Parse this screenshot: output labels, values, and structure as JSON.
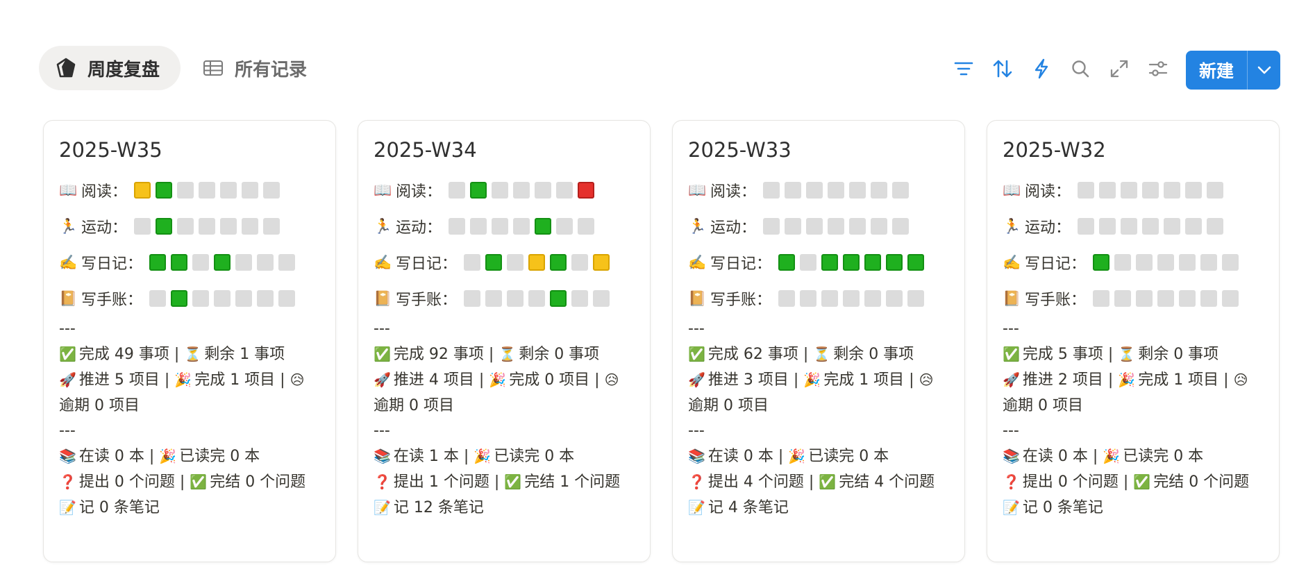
{
  "tabs": [
    {
      "label": "周度复盘",
      "icon": "pentagon-icon",
      "active": true
    },
    {
      "label": "所有记录",
      "icon": "table-icon",
      "active": false
    }
  ],
  "toolbar": {
    "new_label": "新建",
    "accent": "#2383e2",
    "tools": [
      "filter-icon",
      "sort-icon",
      "lightning-icon",
      "search-icon",
      "expand-icon",
      "sliders-icon"
    ]
  },
  "status_colors": {
    "done": "#1fb01f",
    "partial": "#f6c21a",
    "missed": "#e5302c",
    "empty": "#dcdcdc"
  },
  "cards": [
    {
      "title": "2025-W35",
      "habits": [
        {
          "icon": "📖",
          "label": "阅读：",
          "days": [
            "yellow",
            "green",
            "gray",
            "gray",
            "gray",
            "gray",
            "gray"
          ]
        },
        {
          "icon": "🏃",
          "label": "运动：",
          "days": [
            "gray",
            "green",
            "gray",
            "gray",
            "gray",
            "gray",
            "gray"
          ]
        },
        {
          "icon": "✍️",
          "label": "写日记：",
          "days": [
            "green",
            "green",
            "gray",
            "green",
            "gray",
            "gray",
            "gray"
          ]
        },
        {
          "icon": "📔",
          "label": "写手账：",
          "days": [
            "gray",
            "green",
            "gray",
            "gray",
            "gray",
            "gray",
            "gray"
          ]
        }
      ],
      "divider": "---",
      "tasks_done": "完成 49 事项 | ",
      "tasks_left": "剩余 1 事项",
      "proj_push": "推进 5 项目 | ",
      "proj_done": "完成 1 项目 | ",
      "proj_overdue": "逾期 0 项目",
      "reading": "在读 0 本 | ",
      "read_done": "已读完 0 本",
      "q_raised": "提出 0 个问题 | ",
      "q_closed": "完结 0 个问题",
      "notes": "记 0 条笔记"
    },
    {
      "title": "2025-W34",
      "habits": [
        {
          "icon": "📖",
          "label": "阅读：",
          "days": [
            "gray",
            "green",
            "gray",
            "gray",
            "gray",
            "gray",
            "red"
          ]
        },
        {
          "icon": "🏃",
          "label": "运动：",
          "days": [
            "gray",
            "gray",
            "gray",
            "gray",
            "green",
            "gray",
            "gray"
          ]
        },
        {
          "icon": "✍️",
          "label": "写日记：",
          "days": [
            "gray",
            "green",
            "gray",
            "yellow",
            "green",
            "gray",
            "yellow"
          ]
        },
        {
          "icon": "📔",
          "label": "写手账：",
          "days": [
            "gray",
            "gray",
            "gray",
            "gray",
            "green",
            "gray",
            "gray"
          ]
        }
      ],
      "divider": "---",
      "tasks_done": "完成 92 事项 | ",
      "tasks_left": "剩余 0 事项",
      "proj_push": "推进 4 项目 | ",
      "proj_done": "完成 0 项目 | ",
      "proj_overdue": "逾期 0 项目",
      "reading": "在读 1 本 | ",
      "read_done": "已读完 0 本",
      "q_raised": "提出 1 个问题 | ",
      "q_closed": "完结 1 个问题",
      "notes": "记 12 条笔记"
    },
    {
      "title": "2025-W33",
      "habits": [
        {
          "icon": "📖",
          "label": "阅读：",
          "days": [
            "gray",
            "gray",
            "gray",
            "gray",
            "gray",
            "gray",
            "gray"
          ]
        },
        {
          "icon": "🏃",
          "label": "运动：",
          "days": [
            "gray",
            "gray",
            "gray",
            "gray",
            "gray",
            "gray",
            "gray"
          ]
        },
        {
          "icon": "✍️",
          "label": "写日记：",
          "days": [
            "green",
            "gray",
            "green",
            "green",
            "green",
            "green",
            "green"
          ]
        },
        {
          "icon": "📔",
          "label": "写手账：",
          "days": [
            "gray",
            "gray",
            "gray",
            "gray",
            "gray",
            "gray",
            "gray"
          ]
        }
      ],
      "divider": "---",
      "tasks_done": "完成 62 事项 | ",
      "tasks_left": "剩余 0 事项",
      "proj_push": "推进 3 项目 | ",
      "proj_done": "完成 1 项目 | ",
      "proj_overdue": "逾期 0 项目",
      "reading": "在读 0 本 | ",
      "read_done": "已读完 0 本",
      "q_raised": "提出 4 个问题 | ",
      "q_closed": "完结 4 个问题",
      "notes": "记 4 条笔记"
    },
    {
      "title": "2025-W32",
      "habits": [
        {
          "icon": "📖",
          "label": "阅读：",
          "days": [
            "gray",
            "gray",
            "gray",
            "gray",
            "gray",
            "gray",
            "gray"
          ]
        },
        {
          "icon": "🏃",
          "label": "运动：",
          "days": [
            "gray",
            "gray",
            "gray",
            "gray",
            "gray",
            "gray",
            "gray"
          ]
        },
        {
          "icon": "✍️",
          "label": "写日记：",
          "days": [
            "green",
            "gray",
            "gray",
            "gray",
            "gray",
            "gray",
            "gray"
          ]
        },
        {
          "icon": "📔",
          "label": "写手账：",
          "days": [
            "gray",
            "gray",
            "gray",
            "gray",
            "gray",
            "gray",
            "gray"
          ]
        }
      ],
      "divider": "---",
      "tasks_done": "完成 5 事项 | ",
      "tasks_left": "剩余 0 事项",
      "proj_push": "推进 2 项目 | ",
      "proj_done": "完成 1 项目 | ",
      "proj_overdue": "逾期 0 项目",
      "reading": "在读 0 本 | ",
      "read_done": "已读完 0 本",
      "q_raised": "提出 0 个问题 | ",
      "q_closed": "完结 0 个问题",
      "notes": "记 0 条笔记"
    }
  ],
  "emoji": {
    "check": "✅",
    "hourglass": "⏳",
    "rocket": "🚀",
    "party": "🎉",
    "sad": "😥",
    "books": "📚",
    "question": "❓",
    "memo": "📝"
  }
}
